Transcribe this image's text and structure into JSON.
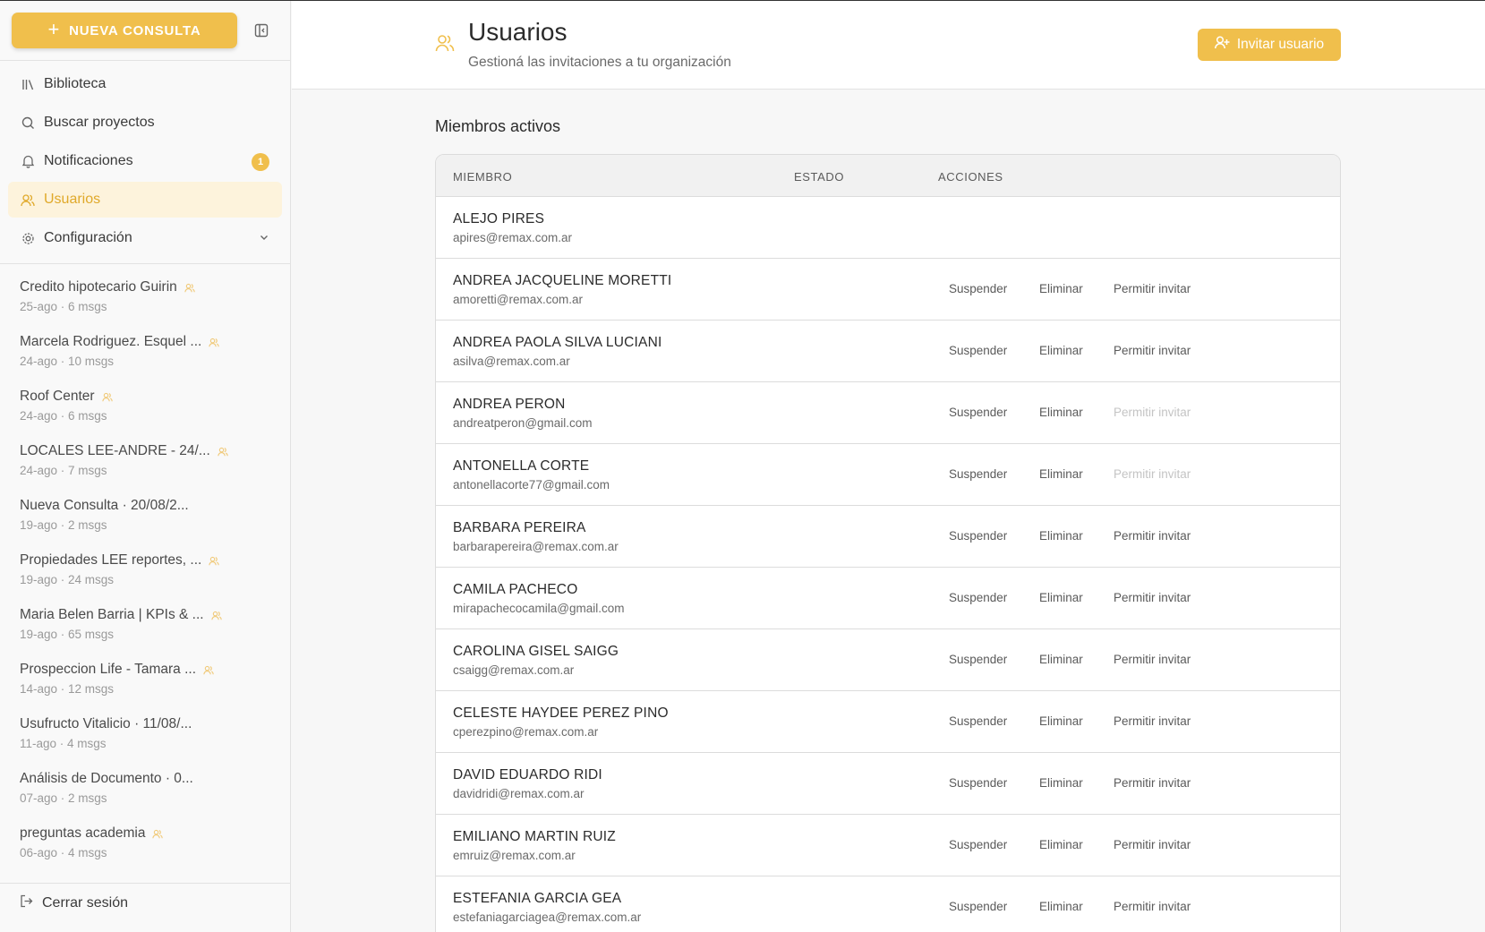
{
  "sidebar": {
    "new_button_label": "NUEVA CONSULTA",
    "nav": [
      {
        "label": "Biblioteca",
        "icon": "library-icon"
      },
      {
        "label": "Buscar proyectos",
        "icon": "search-icon"
      },
      {
        "label": "Notificaciones",
        "icon": "bell-icon",
        "badge": "1"
      },
      {
        "label": "Usuarios",
        "icon": "users-icon",
        "active": true
      },
      {
        "label": "Configuración",
        "icon": "gear-icon"
      }
    ],
    "conversations": [
      {
        "title": "Credito hipotecario Guirin",
        "meta": "25-ago · 6 msgs",
        "shared": true
      },
      {
        "title": "Marcela Rodriguez. Esquel ...",
        "meta": "24-ago · 10 msgs",
        "shared": true
      },
      {
        "title": "Roof Center",
        "meta": "24-ago · 6 msgs",
        "shared": true
      },
      {
        "title": "LOCALES LEE-ANDRE - 24/...",
        "meta": "24-ago · 7 msgs",
        "shared": true
      },
      {
        "title": "Nueva Consulta · 20/08/2...",
        "meta": "19-ago · 2 msgs",
        "shared": false
      },
      {
        "title": "Propiedades LEE reportes, ...",
        "meta": "19-ago · 24 msgs",
        "shared": true
      },
      {
        "title": "Maria Belen Barria | KPIs & ...",
        "meta": "19-ago · 65 msgs",
        "shared": true
      },
      {
        "title": "Prospeccion Life - Tamara ...",
        "meta": "14-ago · 12 msgs",
        "shared": true
      },
      {
        "title": "Usufructo Vitalicio · 11/08/...",
        "meta": "11-ago · 4 msgs",
        "shared": false
      },
      {
        "title": "Análisis de Documento · 0...",
        "meta": "07-ago · 2 msgs",
        "shared": false
      },
      {
        "title": "preguntas academia",
        "meta": "06-ago · 4 msgs",
        "shared": true
      }
    ],
    "logout_label": "Cerrar sesión"
  },
  "header": {
    "title": "Usuarios",
    "subtitle": "Gestioná las invitaciones a tu organización",
    "invite_label": "Invitar usuario"
  },
  "section_title": "Miembros activos",
  "table": {
    "columns": [
      "MIEMBRO",
      "ESTADO",
      "ACCIONES"
    ],
    "action_labels": {
      "suspend": "Suspender",
      "delete": "Eliminar",
      "allow_invite": "Permitir invitar"
    },
    "rows": [
      {
        "name": "ALEJO PIRES",
        "email": "apires@remax.com.ar",
        "actions": false,
        "invite_enabled": false
      },
      {
        "name": "ANDREA JACQUELINE MORETTI",
        "email": "amoretti@remax.com.ar",
        "actions": true,
        "invite_enabled": true
      },
      {
        "name": "ANDREA PAOLA SILVA LUCIANI",
        "email": "asilva@remax.com.ar",
        "actions": true,
        "invite_enabled": true
      },
      {
        "name": "ANDREA PERON",
        "email": "andreatperon@gmail.com",
        "actions": true,
        "invite_enabled": false
      },
      {
        "name": "ANTONELLA CORTE",
        "email": "antonellacorte77@gmail.com",
        "actions": true,
        "invite_enabled": false
      },
      {
        "name": "BARBARA PEREIRA",
        "email": "barbarapereira@remax.com.ar",
        "actions": true,
        "invite_enabled": true
      },
      {
        "name": "CAMILA PACHECO",
        "email": "mirapachecocamila@gmail.com",
        "actions": true,
        "invite_enabled": true
      },
      {
        "name": "CAROLINA GISEL SAIGG",
        "email": "csaigg@remax.com.ar",
        "actions": true,
        "invite_enabled": true
      },
      {
        "name": "CELESTE HAYDEE PEREZ PINO",
        "email": "cperezpino@remax.com.ar",
        "actions": true,
        "invite_enabled": true
      },
      {
        "name": "DAVID EDUARDO RIDI",
        "email": "davidridi@remax.com.ar",
        "actions": true,
        "invite_enabled": true
      },
      {
        "name": "EMILIANO MARTIN RUIZ",
        "email": "emruiz@remax.com.ar",
        "actions": true,
        "invite_enabled": true
      },
      {
        "name": "ESTEFANIA GARCIA GEA",
        "email": "estefaniagarciagea@remax.com.ar",
        "actions": true,
        "invite_enabled": true
      }
    ]
  },
  "colors": {
    "accent": "#f0bf4c",
    "active_bg": "#fdf3dc",
    "active_text": "#e0a92a"
  }
}
